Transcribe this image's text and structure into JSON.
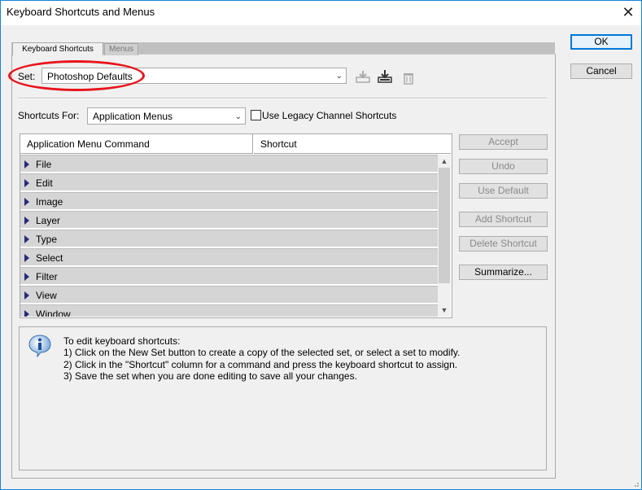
{
  "window": {
    "title": "Keyboard Shortcuts and Menus",
    "close_glyph": "✕"
  },
  "tabs": [
    {
      "label": "Keyboard Shortcuts",
      "active": true
    },
    {
      "label": "Menus",
      "active": false
    }
  ],
  "set": {
    "label": "Set:",
    "value": "Photoshop Defaults",
    "icons": [
      "save-set-icon",
      "new-set-icon",
      "delete-set-icon"
    ]
  },
  "shortcuts_for": {
    "label": "Shortcuts For:",
    "value": "Application Menus",
    "legacy_checkbox_label": "Use Legacy Channel Shortcuts",
    "legacy_checked": false
  },
  "table": {
    "columns": [
      "Application Menu Command",
      "Shortcut"
    ],
    "rows": [
      "File",
      "Edit",
      "Image",
      "Layer",
      "Type",
      "Select",
      "Filter",
      "View",
      "Window"
    ]
  },
  "side_buttons": {
    "accept": "Accept",
    "undo": "Undo",
    "use_default": "Use Default",
    "add_shortcut": "Add Shortcut",
    "delete_shortcut": "Delete Shortcut",
    "summarize": "Summarize..."
  },
  "dialog_buttons": {
    "ok": "OK",
    "cancel": "Cancel"
  },
  "info": {
    "lines": [
      "To edit keyboard shortcuts:",
      "1) Click on the New Set button to create a copy of the selected set, or select a set to modify.",
      "2) Click in the \"Shortcut\" column for a command and press the keyboard shortcut to assign.",
      "3) Save the set when you are done editing to save all your changes."
    ]
  },
  "colors": {
    "highlight_ellipse": "#e8141c",
    "accent": "#0078d7"
  }
}
